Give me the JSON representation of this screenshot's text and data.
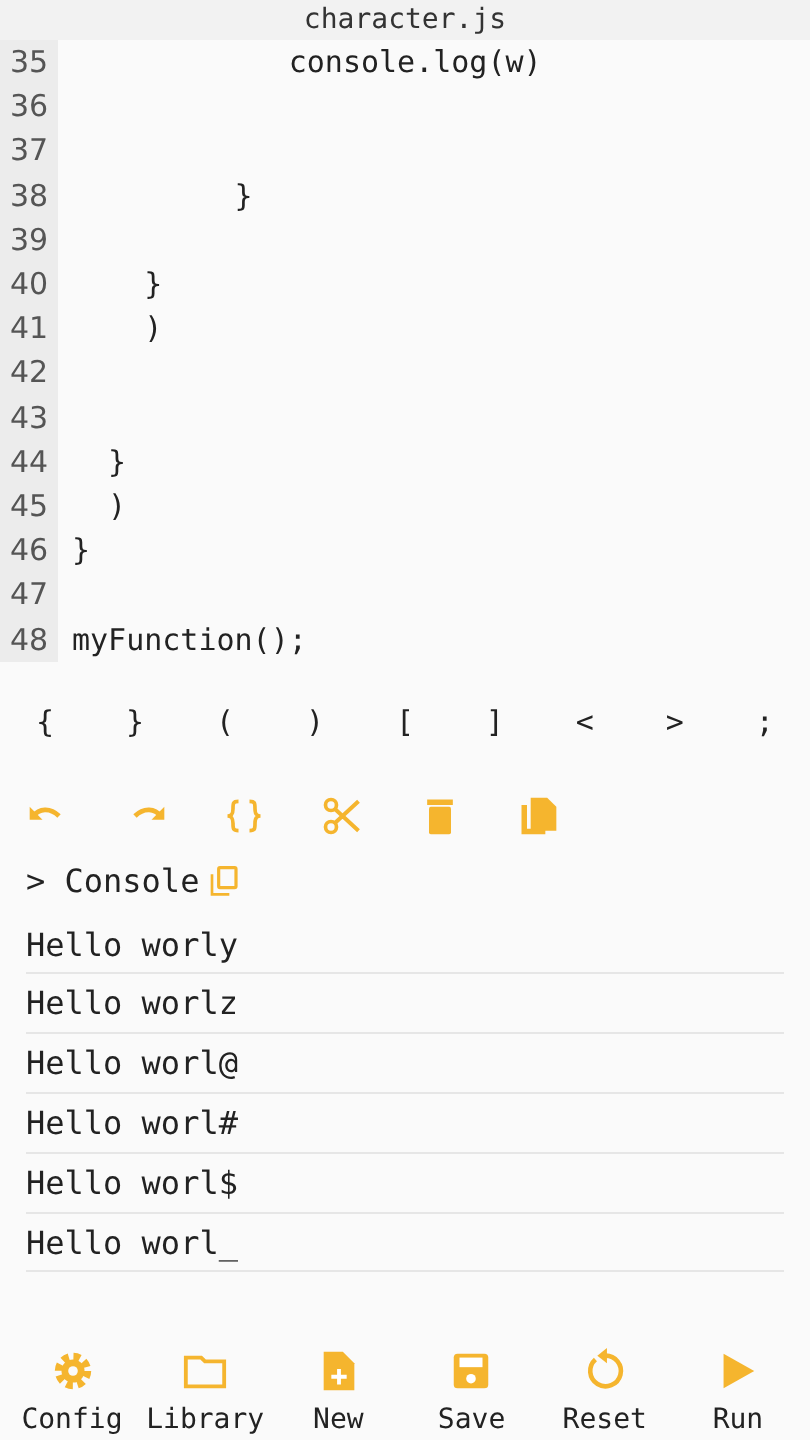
{
  "file": {
    "title": "character.js"
  },
  "code_lines": [
    {
      "number": "35",
      "text": "            console.log(w)"
    },
    {
      "number": "36"
    },
    {
      "number": "37"
    },
    {
      "number": "38",
      "text": "         }"
    },
    {
      "number": "39"
    },
    {
      "number": "40",
      "text": "    }"
    },
    {
      "number": "41",
      "text": "    )"
    },
    {
      "number": "42"
    },
    {
      "number": "43"
    },
    {
      "number": "44",
      "text": "  }"
    },
    {
      "number": "45",
      "text": "  )"
    },
    {
      "number": "46",
      "text": "}"
    },
    {
      "number": "47"
    },
    {
      "number": "48",
      "text": "myFunction();"
    }
  ],
  "symbol_keys": [
    "{",
    "}",
    "(",
    ")",
    "[",
    "]",
    "<",
    ">",
    ";"
  ],
  "toolbar": [
    {
      "kind": "undo"
    },
    {
      "kind": "redo"
    },
    {
      "kind": "braces"
    },
    {
      "kind": "cut"
    },
    {
      "kind": "delete"
    },
    {
      "kind": "copy"
    }
  ],
  "console": {
    "title": "> Console",
    "lines": [
      "Hello worly",
      "Hello worlz",
      "Hello worl@",
      "Hello worl#",
      "Hello worl$",
      "Hello worl_"
    ]
  },
  "nav": [
    {
      "label": "Config",
      "kind": "config"
    },
    {
      "label": "Library",
      "kind": "library"
    },
    {
      "label": "New",
      "kind": "new"
    },
    {
      "label": "Save",
      "kind": "save"
    },
    {
      "label": "Reset",
      "kind": "reset"
    },
    {
      "label": "Run",
      "kind": "run"
    }
  ]
}
